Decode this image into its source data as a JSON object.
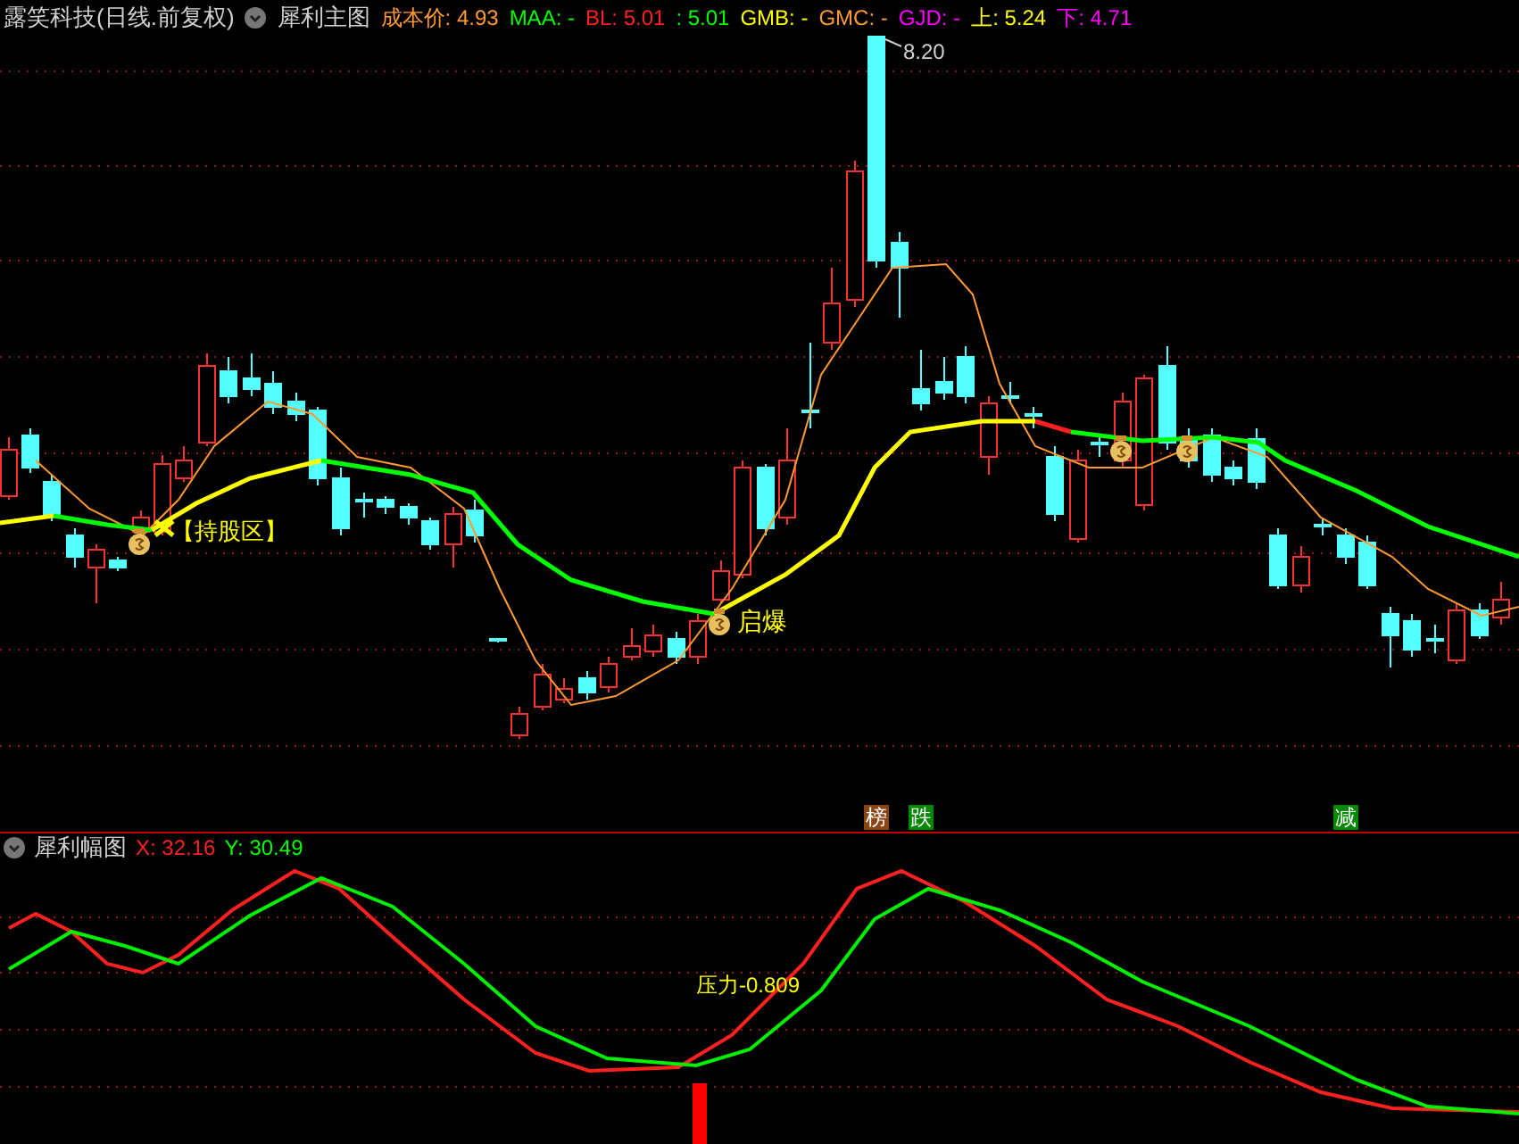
{
  "header": {
    "stock": "露笑科技(日线.前复权)",
    "indicator": "犀利主图",
    "items": [
      {
        "text": "成本价: 4.93",
        "color": "#ff9933"
      },
      {
        "text": "MAA: -",
        "color": "#00ff00"
      },
      {
        "text": "BL: 5.01",
        "color": "#ff2020"
      },
      {
        "text": ": 5.01",
        "color": "#00ff00"
      },
      {
        "text": "GMB: -",
        "color": "#ffff00"
      },
      {
        "text": "GMC: -",
        "color": "#ff9933"
      },
      {
        "text": "GJD: -",
        "color": "#ff00ff"
      },
      {
        "text": "上: 5.24",
        "color": "#ffff00"
      },
      {
        "text": "下: 4.71",
        "color": "#ff00ff"
      }
    ]
  },
  "main_chart": {
    "peak_label": "8.20",
    "annotations": [
      "【持股区】",
      "启爆"
    ],
    "signals": [
      {
        "text": "榜",
        "color": "#8b4513"
      },
      {
        "text": "跌",
        "color": "#008800"
      },
      {
        "text": "减",
        "color": "#008800"
      }
    ]
  },
  "sub_chart": {
    "title": "犀利幅图",
    "readings": [
      {
        "text": "X: 32.16",
        "color": "#ff2020"
      },
      {
        "text": "Y: 30.49",
        "color": "#00ff00"
      }
    ],
    "pressure": "压力-0.809"
  }
}
